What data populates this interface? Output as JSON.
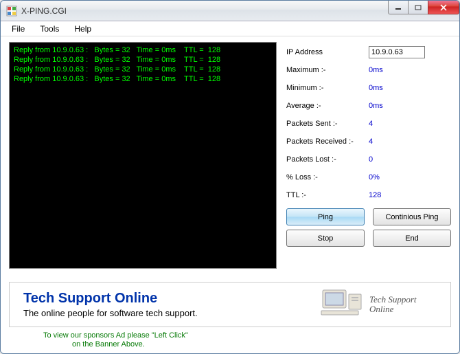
{
  "window": {
    "title": "X-PING.CGI"
  },
  "menubar": {
    "items": [
      "File",
      "Tools",
      "Help"
    ]
  },
  "console": {
    "lines": [
      "Reply from 10.9.0.63 :   Bytes = 32   Time = 0ms    TTL =  128",
      "Reply from 10.9.0.63 :   Bytes = 32   Time = 0ms    TTL =  128",
      "Reply from 10.9.0.63 :   Bytes = 32   Time = 0ms    TTL =  128",
      "Reply from 10.9.0.63 :   Bytes = 32   Time = 0ms    TTL =  128"
    ]
  },
  "stats": {
    "ip_label": "IP Address",
    "ip_value": "10.9.0.63",
    "rows": [
      {
        "label": "Maximum :-",
        "value": "0ms"
      },
      {
        "label": "Minimum :-",
        "value": "0ms"
      },
      {
        "label": "Average :-",
        "value": "0ms"
      },
      {
        "label": "Packets Sent :-",
        "value": "4"
      },
      {
        "label": "Packets Received :-",
        "value": "4"
      },
      {
        "label": "Packets Lost :-",
        "value": "0"
      },
      {
        "label": "% Loss :-",
        "value": "0%"
      },
      {
        "label": "TTL :-",
        "value": "128"
      }
    ]
  },
  "buttons": {
    "ping": "Ping",
    "continuous": "Continious Ping",
    "stop": "Stop",
    "end": "End"
  },
  "banner": {
    "title": "Tech Support Online",
    "subtitle": "The online people for software tech support.",
    "script_text": "Tech Support Online"
  },
  "sponsor": {
    "line1": "To view our sponsors Ad please \"Left Click\"",
    "line2": "on the Banner Above."
  }
}
